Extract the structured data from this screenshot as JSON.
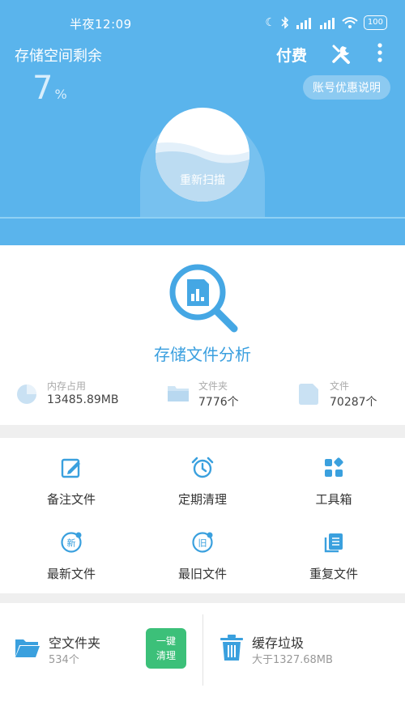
{
  "status_bar": {
    "time": "半夜12:09",
    "battery": "100"
  },
  "header": {
    "title": "存储空间剩余",
    "pay_label": "付费",
    "percent_value": "7",
    "percent_unit": "%",
    "account_button": "账号优惠说明",
    "rescan_label": "重新扫描"
  },
  "analysis": {
    "title": "存储文件分析",
    "stats": [
      {
        "label": "内存占用",
        "value": "13485.89MB"
      },
      {
        "label": "文件夹",
        "value": "7776个"
      },
      {
        "label": "文件",
        "value": "70287个"
      }
    ]
  },
  "grid": {
    "items": [
      {
        "label": "备注文件"
      },
      {
        "label": "定期清理"
      },
      {
        "label": "工具箱"
      },
      {
        "label": "最新文件",
        "icon_text": "新"
      },
      {
        "label": "最旧文件",
        "icon_text": "旧"
      },
      {
        "label": "重复文件"
      }
    ]
  },
  "bottom": {
    "empty_folder_title": "空文件夹",
    "empty_folder_count": "534个",
    "clean_button_line1": "一键",
    "clean_button_line2": "清理",
    "cache_title": "缓存垃圾",
    "cache_size": "大于1327.68MB"
  },
  "colors": {
    "header_bg": "#5ab4ec",
    "accent": "#3a9fdf",
    "clean_button": "#3cc079"
  }
}
